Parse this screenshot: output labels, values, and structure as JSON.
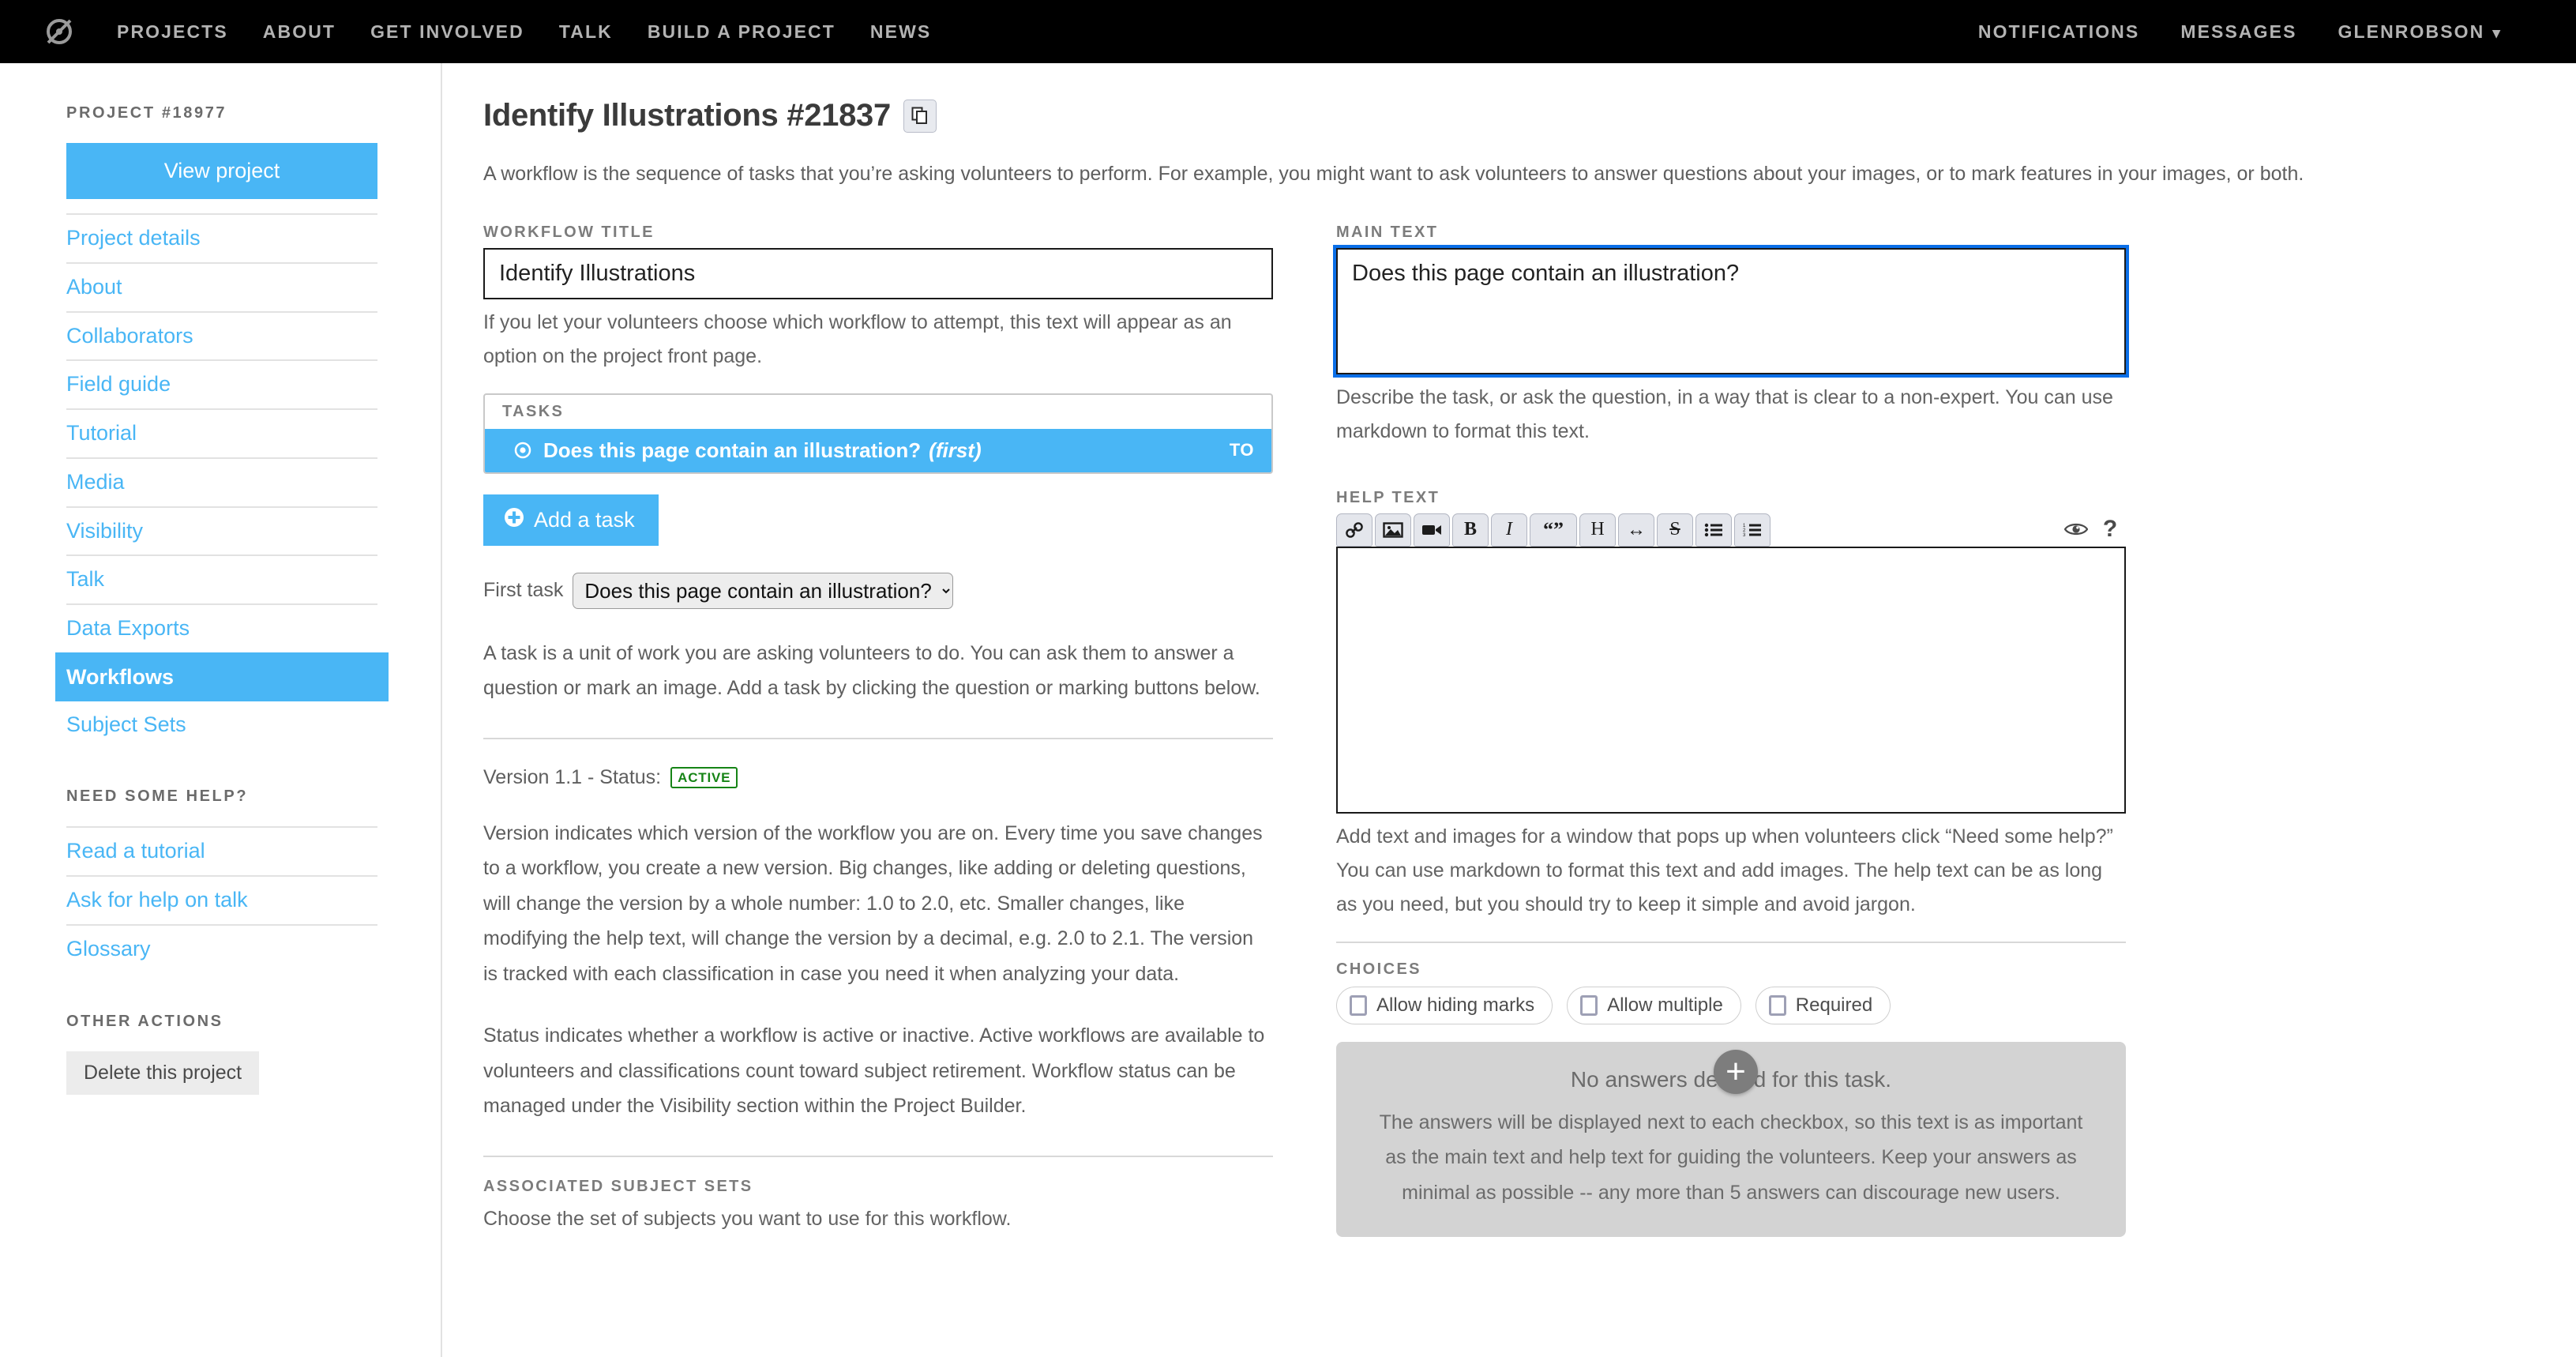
{
  "colors": {
    "accent": "#49b6f5",
    "nav_bg": "#000000",
    "active_badge": "#168416",
    "focus_ring": "#0b6fe8"
  },
  "topnav": {
    "logo_name": "zooniverse-logo",
    "left_links": [
      "PROJECTS",
      "ABOUT",
      "GET INVOLVED",
      "TALK",
      "BUILD A PROJECT",
      "NEWS"
    ],
    "right_links": [
      "NOTIFICATIONS",
      "MESSAGES"
    ],
    "user": "GLENROBSON",
    "user_caret": "⌄"
  },
  "sidebar": {
    "project_heading": "PROJECT #18977",
    "view_project_label": "View project",
    "items": [
      "Project details",
      "About",
      "Collaborators",
      "Field guide",
      "Tutorial",
      "Media",
      "Visibility",
      "Talk",
      "Data Exports",
      "Workflows",
      "Subject Sets"
    ],
    "active_item": "Workflows",
    "help_heading": "NEED SOME HELP?",
    "help_items": [
      "Read a tutorial",
      "Ask for help on talk",
      "Glossary"
    ],
    "other_heading": "OTHER ACTIONS",
    "delete_label": "Delete this project"
  },
  "main": {
    "page_title": "Identify Illustrations #21837",
    "copy_icon": "copy-icon",
    "intro": "A workflow is the sequence of tasks that you’re asking volunteers to perform. For example, you might want to ask volunteers to answer questions about your images, or to mark features in your images, or both."
  },
  "left_col": {
    "workflow_title_label": "WORKFLOW TITLE",
    "workflow_title_value": "Identify Illustrations",
    "workflow_title_helper": "If you let your volunteers choose which workflow to attempt, this text will appear as an option on the project front page.",
    "tasks_label": "TASKS",
    "task_rows": [
      {
        "icon": "radio-icon",
        "label": "Does this page contain an illustration?",
        "note": "(first)",
        "end": "TO"
      }
    ],
    "add_task_label": "Add a task",
    "add_task_icon": "plus-circle-icon",
    "first_task_label": "First task",
    "first_task_selected": "Does this page contain an illustration?",
    "first_task_options": [
      "Does this page contain an illustration?"
    ],
    "task_helper": "A task is a unit of work you are asking volunteers to do. You can ask them to answer a question or mark an image. Add a task by clicking the question or marking buttons below.",
    "version_prefix": "Version 1.1 - Status:",
    "version_badge": "ACTIVE",
    "version_para": "Version indicates which version of the workflow you are on. Every time you save changes to a workflow, you create a new version. Big changes, like adding or deleting questions, will change the version by a whole number: 1.0 to 2.0, etc. Smaller changes, like modifying the help text, will change the version by a decimal, e.g. 2.0 to 2.1. The version is tracked with each classification in case you need it when analyzing your data.",
    "status_para": "Status indicates whether a workflow is active or inactive. Active workflows are available to volunteers and classifications count toward subject retirement. Workflow status can be managed under the Visibility section within the Project Builder.",
    "subject_sets_label": "ASSOCIATED SUBJECT SETS",
    "subject_sets_helper": "Choose the set of subjects you want to use for this workflow."
  },
  "right_col": {
    "main_text_label": "MAIN TEXT",
    "main_text_value": "Does this page contain an illustration?",
    "main_text_helper": "Describe the task, or ask the question, in a way that is clear to a non-expert. You can use markdown to format this text.",
    "help_text_label": "HELP TEXT",
    "help_text_value": "",
    "toolbar_buttons": [
      {
        "icon": "link-icon",
        "glyph": "🔗"
      },
      {
        "icon": "image-icon",
        "glyph": "🖼"
      },
      {
        "icon": "video-icon",
        "glyph": "🎥"
      },
      {
        "icon": "bold-icon",
        "glyph": "B"
      },
      {
        "icon": "italic-icon",
        "glyph": "I"
      },
      {
        "icon": "blockquote-icon",
        "glyph": "“”"
      },
      {
        "icon": "heading-icon",
        "glyph": "H"
      },
      {
        "icon": "horizontal-rule-icon",
        "glyph": "↔"
      },
      {
        "icon": "strikethrough-icon",
        "glyph": "S"
      },
      {
        "icon": "bullet-list-icon",
        "glyph": "☰"
      },
      {
        "icon": "numbered-list-icon",
        "glyph": "☰"
      }
    ],
    "preview_icon": "eye-icon",
    "help_icon": "question-mark-icon",
    "help_text_helper": "Add text and images for a window that pops up when volunteers click “Need some help?” You can use markdown to format this text and add images. The help text can be as long as you need, but you should try to keep it simple and avoid jargon.",
    "choices_label": "CHOICES",
    "choices": [
      {
        "label": "Allow hiding marks",
        "checked": false
      },
      {
        "label": "Allow multiple",
        "checked": false
      },
      {
        "label": "Required",
        "checked": false
      }
    ],
    "no_answers_title": "No answers defined for this task.",
    "no_answers_body": "The answers will be displayed next to each checkbox, so this text is as important as the main text and help text for guiding the volunteers. Keep your answers as minimal as possible -- any more than 5 answers can discourage new users.",
    "add_answer_icon": "plus-icon",
    "add_answer_glyph": "+"
  }
}
